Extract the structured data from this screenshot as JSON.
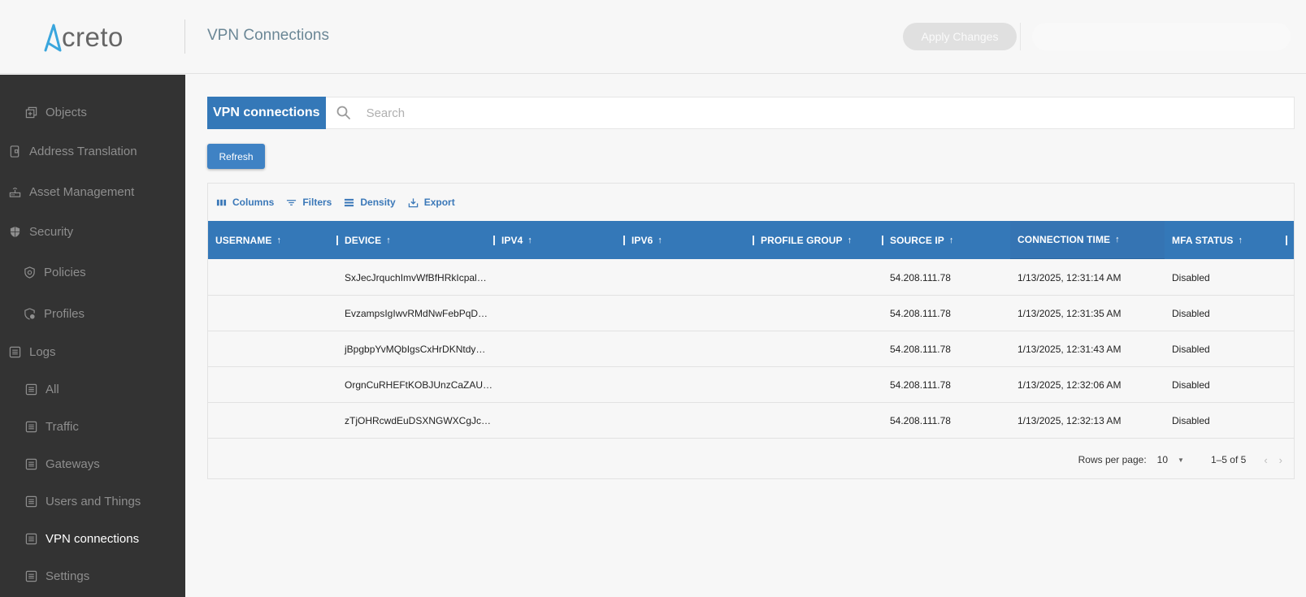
{
  "header": {
    "logo_text": "creto",
    "title": "VPN Connections",
    "apply_label": "Apply Changes"
  },
  "sidebar": {
    "items": [
      {
        "label": "Objects",
        "icon": "objects-icon",
        "active": false
      },
      {
        "label": "Address Translation",
        "icon": "address-translation-icon",
        "active": false
      },
      {
        "label": "Asset Management",
        "icon": "router-icon",
        "active": false
      },
      {
        "label": "Security",
        "icon": "shield-icon",
        "active": false
      },
      {
        "label": "Policies",
        "icon": "policy-shield-icon",
        "active": false
      },
      {
        "label": "Profiles",
        "icon": "profile-shield-icon",
        "active": false
      },
      {
        "label": "Logs",
        "icon": "log-icon",
        "active": false
      },
      {
        "label": "All",
        "icon": "log-icon",
        "active": false
      },
      {
        "label": "Traffic",
        "icon": "log-icon",
        "active": false
      },
      {
        "label": "Gateways",
        "icon": "log-icon",
        "active": false
      },
      {
        "label": "Users and Things",
        "icon": "log-icon",
        "active": false
      },
      {
        "label": "VPN connections",
        "icon": "log-icon",
        "active": true
      },
      {
        "label": "Settings",
        "icon": "log-icon",
        "active": false
      }
    ]
  },
  "search": {
    "chip_label": "VPN connections",
    "placeholder": "Search",
    "value": ""
  },
  "refresh_label": "Refresh",
  "toolbar": {
    "columns": "Columns",
    "filters": "Filters",
    "density": "Density",
    "export": "Export"
  },
  "table": {
    "columns": [
      "USERNAME",
      "DEVICE",
      "IPV4",
      "IPV6",
      "PROFILE GROUP",
      "SOURCE IP",
      "CONNECTION TIME",
      "MFA STATUS"
    ],
    "rows": [
      {
        "username": "",
        "device": "SxJecJrquchImvWfBfHRkIcpal…",
        "ipv4": "",
        "ipv6": "",
        "profile_group": "",
        "source_ip": "54.208.111.78",
        "connection_time": "1/13/2025, 12:31:14 AM",
        "mfa_status": "Disabled"
      },
      {
        "username": "",
        "device": "EvzampsIgIwvRMdNwFebPqD…",
        "ipv4": "",
        "ipv6": "",
        "profile_group": "",
        "source_ip": "54.208.111.78",
        "connection_time": "1/13/2025, 12:31:35 AM",
        "mfa_status": "Disabled"
      },
      {
        "username": "",
        "device": "jBpgbpYvMQbIgsCxHrDKNtdy…",
        "ipv4": "",
        "ipv6": "",
        "profile_group": "",
        "source_ip": "54.208.111.78",
        "connection_time": "1/13/2025, 12:31:43 AM",
        "mfa_status": "Disabled"
      },
      {
        "username": "",
        "device": "OrgnCuRHEFtKOBJUnzCaZAU…",
        "ipv4": "",
        "ipv6": "",
        "profile_group": "",
        "source_ip": "54.208.111.78",
        "connection_time": "1/13/2025, 12:32:06 AM",
        "mfa_status": "Disabled"
      },
      {
        "username": "",
        "device": "zTjOHRcwdEuDSXNGWXCgJc…",
        "ipv4": "",
        "ipv6": "",
        "profile_group": "",
        "source_ip": "54.208.111.78",
        "connection_time": "1/13/2025, 12:32:13 AM",
        "mfa_status": "Disabled"
      }
    ]
  },
  "footer": {
    "rows_per_page_label": "Rows per page:",
    "rows_per_page_value": "10",
    "range": "1–5 of 5",
    "prev": "‹",
    "next": "›"
  },
  "colors": {
    "accent": "#3478b8",
    "sidebar_bg": "#333333",
    "logo_accent": "#3aa6dd"
  }
}
